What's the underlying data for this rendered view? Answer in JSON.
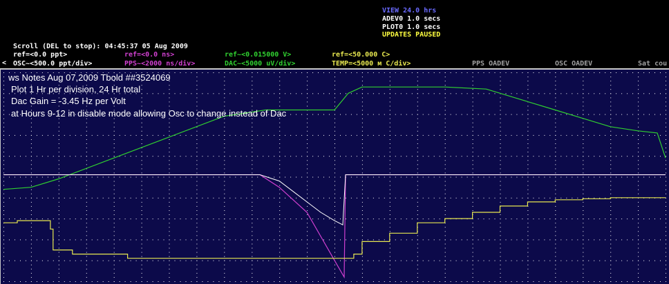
{
  "colors": {
    "plot_bg": "#0c0a4a",
    "grid": "#ffffff",
    "osc": "#ffffff",
    "pps": "#d040d0",
    "dac": "#30d030",
    "temp": "#e8e850",
    "view": "#6a6aff",
    "status": "#ffffff",
    "paused": "#ffff40",
    "header_gray": "#a0a0a0"
  },
  "status": {
    "view": "VIEW 24.0 hrs",
    "adev": "ADEV0 1.0 secs",
    "plot": "PLOT0 1.0 secs",
    "paused": "UPDATES PAUSED"
  },
  "scroll_line": "Scroll (DEL to stop): 04:45:37  05 Aug 2009",
  "ref": {
    "osc": "ref=<0.0 ppt>",
    "pps": "ref=<0.0 ns>",
    "dac": "ref~<0.015000 V>",
    "temp": "ref=<50.000  C>"
  },
  "scale": {
    "osc": "OSC~<500.0 ppt/div>",
    "pps": "PPS~<2000 ns/div>",
    "dac": "DAC~<5000 uV/div>",
    "temp": "TEMP=<5000 м C/div>",
    "pps_oadev": "PPS OADEV",
    "osc_oadev": "OSC OADEV",
    "sat": "Sat cou"
  },
  "notes": {
    "line1": "ws Notes Aug 07,2009 Tbold ##3524069",
    "line2": "Plot 1 Hr per division, 24 Hr total",
    "line3": "Dac Gain = -3.45 Hz per Volt",
    "line4": "at Hours 9-12 in disable mode allowing Osc to change instead of Dac"
  },
  "chart_data": {
    "type": "line",
    "x_unit": "hours",
    "xlim": [
      0,
      24
    ],
    "ylim_divisions": [
      0,
      10
    ],
    "grid": true,
    "series": [
      {
        "name": "DAC",
        "x": [
          0,
          1,
          2,
          4,
          6,
          8,
          9.5,
          12,
          12.5,
          13,
          14,
          16,
          17.5,
          19,
          20,
          21,
          22,
          23,
          23.7,
          24
        ],
        "y": [
          4.4,
          4.5,
          4.9,
          5.9,
          6.9,
          7.9,
          8.2,
          8.2,
          9.0,
          9.3,
          9.3,
          9.3,
          9.2,
          8.6,
          8.2,
          7.8,
          7.4,
          7.2,
          7.1,
          5.9
        ]
      },
      {
        "name": "PPS",
        "x": [
          0,
          1,
          4,
          8,
          9.3,
          10,
          11,
          12,
          12.35,
          12.4,
          13,
          16,
          20,
          24
        ],
        "y": [
          5.1,
          5.1,
          5.1,
          5.1,
          5.1,
          4.5,
          3.3,
          1.0,
          0.2,
          5.1,
          5.1,
          5.1,
          5.1,
          5.1
        ]
      },
      {
        "name": "OSC",
        "x": [
          0,
          4,
          8,
          9.3,
          10,
          10.5,
          11,
          11.5,
          12,
          12.3,
          12.4,
          13,
          16,
          20,
          24
        ],
        "y": [
          5.1,
          5.1,
          5.1,
          5.1,
          4.8,
          4.3,
          3.8,
          3.3,
          2.9,
          2.7,
          5.1,
          5.1,
          5.1,
          5.1,
          5.1
        ]
      },
      {
        "name": "TEMP",
        "x": [
          0,
          0.5,
          1,
          1.7,
          1.8,
          2.5,
          4.5,
          6,
          8,
          10,
          12,
          12.7,
          13,
          14,
          15,
          16,
          17,
          18,
          19,
          20,
          21,
          22,
          23,
          24
        ],
        "y": [
          2.8,
          2.9,
          2.9,
          2.5,
          1.5,
          1.3,
          1.1,
          1.1,
          1.1,
          1.1,
          1.1,
          1.3,
          1.9,
          2.3,
          2.8,
          3.0,
          3.3,
          3.6,
          3.8,
          3.9,
          3.95,
          4.0,
          4.0,
          4.0
        ]
      }
    ]
  }
}
